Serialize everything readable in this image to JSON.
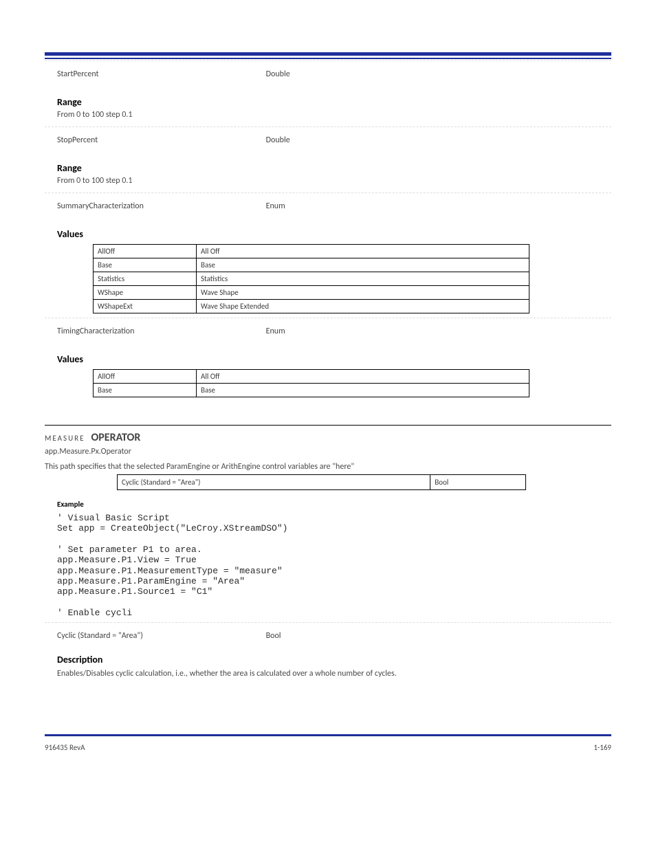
{
  "rows": {
    "startPercent": {
      "name": "StartPercent",
      "type": "Double",
      "range_label": "Range",
      "range": "From 0 to 100 step 0.1"
    },
    "stopPercent": {
      "name": "StopPercent",
      "type": "Double",
      "range_label": "Range",
      "range": "From 0 to 100 step 0.1"
    },
    "summaryChar": {
      "name": "SummaryCharacterization",
      "type": "Enum",
      "values_label": "Values",
      "items": {
        "0": {
          "k": "AllOff",
          "d": "All Off"
        },
        "1": {
          "k": "Base",
          "d": "Base"
        },
        "2": {
          "k": "Statistics",
          "d": "Statistics"
        },
        "3": {
          "k": "WShape",
          "d": "Wave Shape"
        },
        "4": {
          "k": "WShapeExt",
          "d": "Wave Shape Extended"
        }
      }
    },
    "timingChar": {
      "name": "TimingCharacterization",
      "type": "Enum",
      "values_label": "Values",
      "items": {
        "0": {
          "k": "AllOff",
          "d": "All Off"
        },
        "1": {
          "k": "Base",
          "d": "Base"
        }
      }
    }
  },
  "operator": {
    "heading_prefix": "MEASURE",
    "heading_name": "OPERATOR",
    "path": "app.Measure.Px.Operator",
    "intro": "This path specifies that the selected ParamEngine or ArithEngine control variables are \"here\"",
    "mini": {
      "left": "Cyclic (Standard = \"Area\")",
      "right": "Bool"
    },
    "example_label": "Example",
    "code": "' Visual Basic Script\nSet app = CreateObject(\"LeCroy.XStreamDSO\")\n\n' Set parameter P1 to area.\napp.Measure.P1.View = True\napp.Measure.P1.MeasurementType = \"measure\"\napp.Measure.P1.ParamEngine = \"Area\"\napp.Measure.P1.Source1 = \"C1\"\n\n' Enable cycli"
  },
  "cyclic": {
    "prop_name": "Cyclic (Standard = \"Area\")",
    "prop_type": "Bool",
    "desc_label": "Description",
    "desc_text": "Enables/Disables cyclic calculation, i.e., whether the area is calculated over a whole number of cycles."
  },
  "footer": {
    "page": "1-169",
    "ref": "916435 RevA"
  }
}
